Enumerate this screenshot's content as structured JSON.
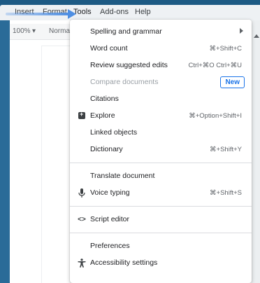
{
  "menubar": {
    "items": [
      "Insert",
      "Format",
      "Tools",
      "Add-ons",
      "Help"
    ]
  },
  "toolbar": {
    "zoom": "100%",
    "style": "Normal"
  },
  "tools_menu": {
    "items": [
      {
        "label": "Spelling and grammar",
        "shortcut": "",
        "has_submenu": true
      },
      {
        "label": "Word count",
        "shortcut": "⌘+Shift+C"
      },
      {
        "label": "Review suggested edits",
        "shortcut": "Ctrl+⌘O Ctrl+⌘U"
      },
      {
        "label": "Compare documents",
        "badge": "New",
        "disabled": true
      },
      {
        "label": "Citations",
        "shortcut": ""
      },
      {
        "label": "Explore",
        "shortcut": "⌘+Option+Shift+I",
        "icon": "explore-icon"
      },
      {
        "label": "Linked objects",
        "shortcut": ""
      },
      {
        "label": "Dictionary",
        "shortcut": "⌘+Shift+Y"
      },
      {
        "label": "Translate document",
        "shortcut": ""
      },
      {
        "label": "Voice typing",
        "shortcut": "⌘+Shift+S",
        "icon": "microphone-icon"
      },
      {
        "label": "Script editor",
        "shortcut": "",
        "icon": "code-icon"
      },
      {
        "label": "Preferences",
        "shortcut": ""
      },
      {
        "label": "Accessibility settings",
        "shortcut": "",
        "icon": "accessibility-icon"
      }
    ]
  },
  "colors": {
    "accent": "#1a73e8",
    "frame": "#1d5a84"
  }
}
